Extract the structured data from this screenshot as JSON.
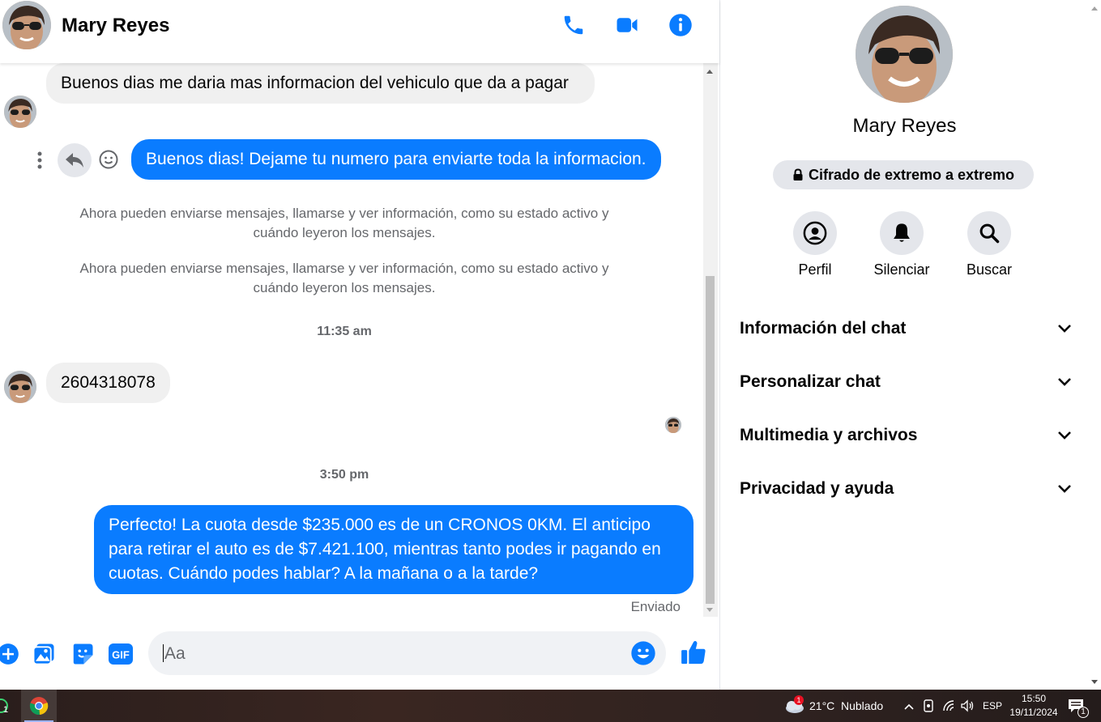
{
  "header": {
    "contact_name": "Mary Reyes",
    "icons": [
      "phone-icon",
      "video-icon",
      "info-icon"
    ]
  },
  "messages": [
    {
      "direction": "incoming",
      "text": "Buenos dias me daria mas informacion del vehiculo que da a pagar"
    },
    {
      "direction": "outgoing",
      "text": "Buenos dias! Dejame tu numero para enviarte toda la informacion."
    },
    {
      "type": "system",
      "text": "Ahora pueden enviarse mensajes, llamarse y ver información, como su estado activo y cuándo leyeron los mensajes."
    },
    {
      "type": "system",
      "text": "Ahora pueden enviarse mensajes, llamarse y ver información, como su estado activo y cuándo leyeron los mensajes."
    },
    {
      "type": "timestamp",
      "text": "11:35 am"
    },
    {
      "direction": "incoming",
      "text": "2604318078"
    },
    {
      "type": "timestamp",
      "text": "3:50 pm"
    },
    {
      "direction": "outgoing",
      "text": "Perfecto! La cuota desde $235.000 es de un CRONOS 0KM. El anticipo para retirar el auto es de $7.421.100, mientras tanto podes ir pagando en cuotas. Cuándo podes hablar? A la mañana o a la tarde?"
    }
  ],
  "status": "Enviado",
  "composer": {
    "placeholder": "Aa",
    "value": "",
    "icons": [
      "plus-icon",
      "image-icon",
      "sticker-icon",
      "gif-icon",
      "emoji-icon",
      "like-icon"
    ]
  },
  "right_panel": {
    "name": "Mary Reyes",
    "encryption_label": "Cifrado de extremo a extremo",
    "actions": [
      {
        "label": "Perfil",
        "icon": "profile-icon"
      },
      {
        "label": "Silenciar",
        "icon": "bell-icon"
      },
      {
        "label": "Buscar",
        "icon": "search-icon"
      }
    ],
    "sections": [
      {
        "label": "Información del chat"
      },
      {
        "label": "Personalizar chat"
      },
      {
        "label": "Multimedia y archivos"
      },
      {
        "label": "Privacidad y ayuda"
      }
    ]
  },
  "taskbar": {
    "notification_badge": "1",
    "weather_badge": "1",
    "temperature": "21°C",
    "weather": "Nublado",
    "language": "ESP",
    "time": "15:50",
    "date": "19/11/2024",
    "notifications_count": "1"
  },
  "colors": {
    "accent": "#0a7cff",
    "incoming_bubble": "#f0f0f0",
    "meta_text": "#65676b"
  }
}
